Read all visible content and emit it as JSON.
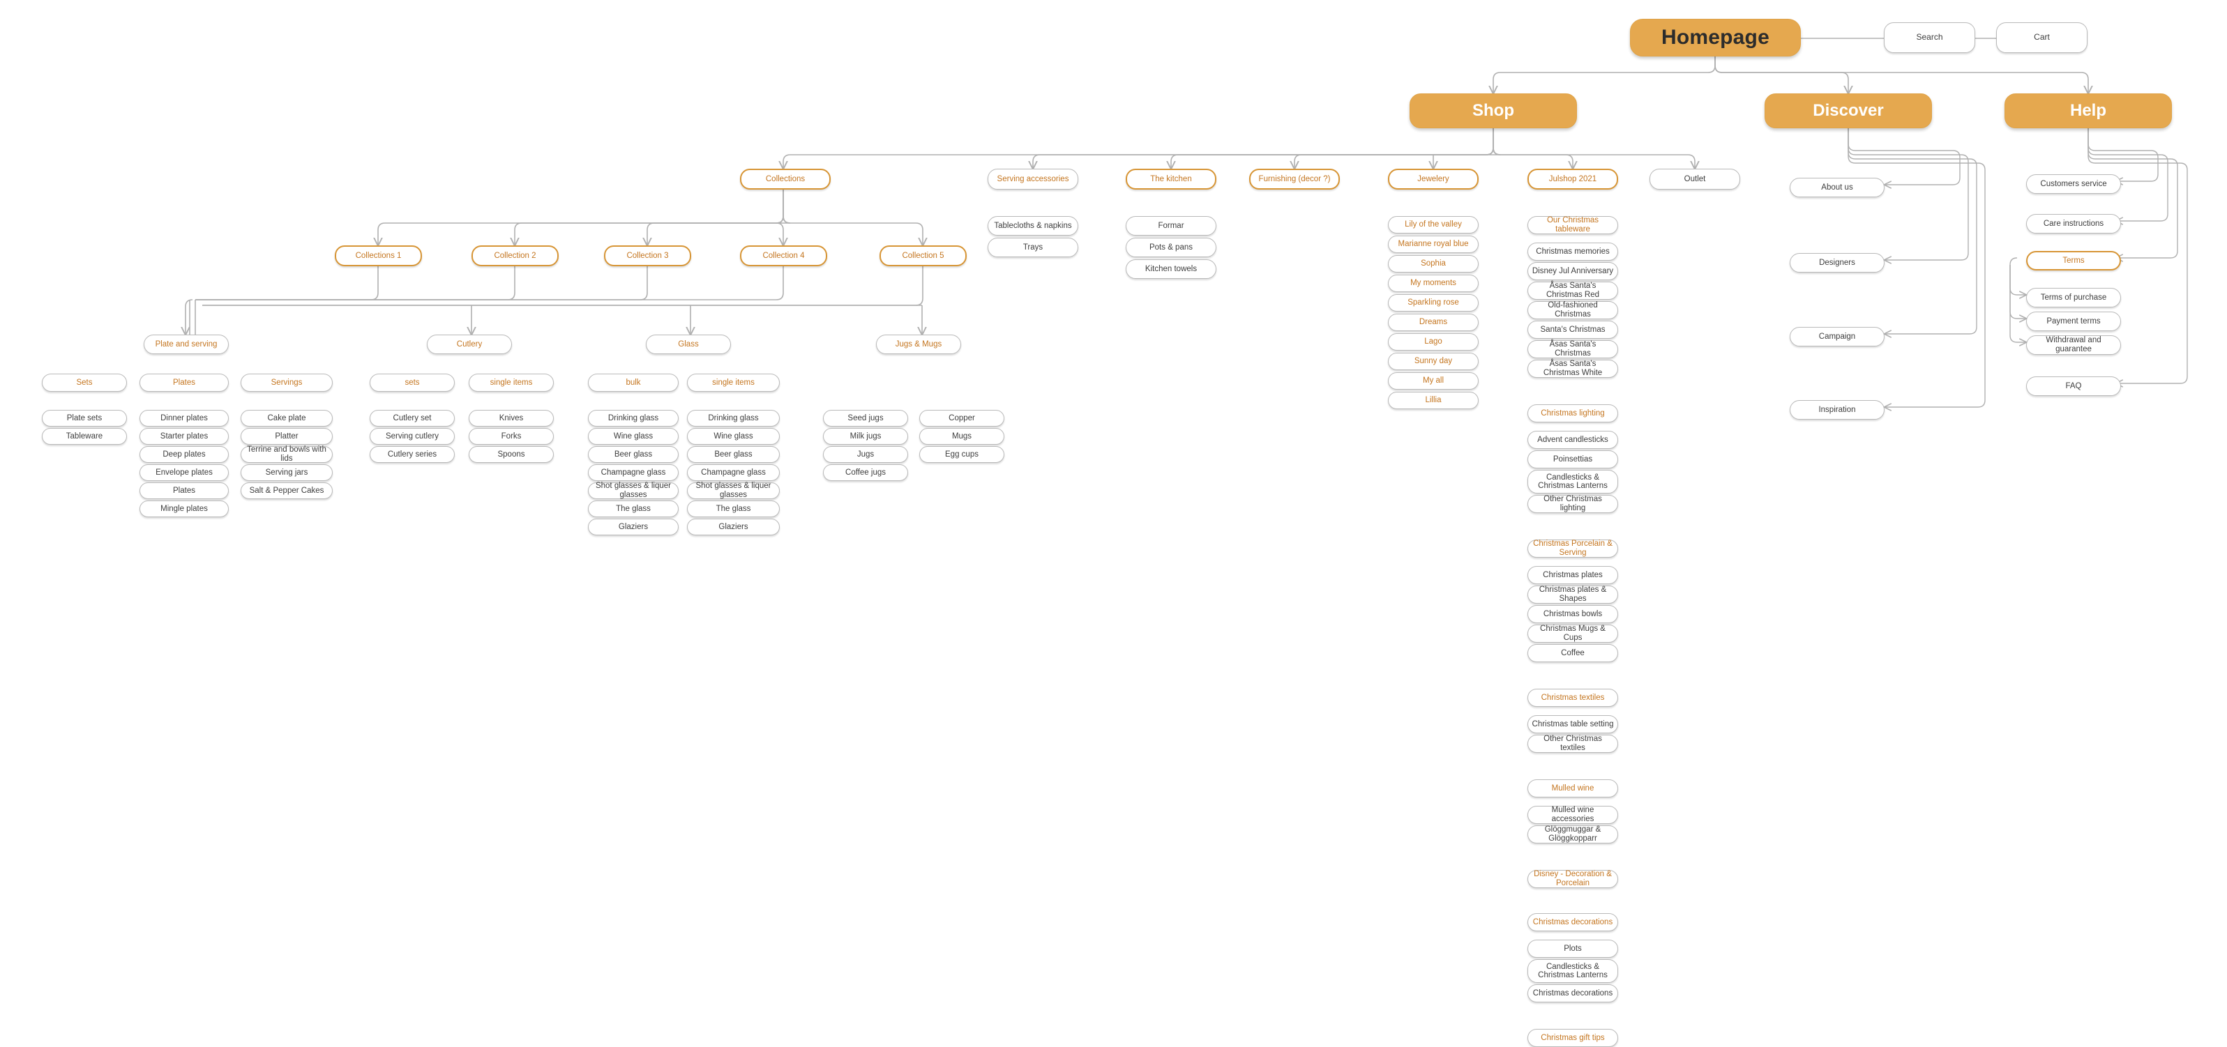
{
  "meta": {
    "diagram_title": "Homepage sitemap",
    "colors": {
      "accent": "#e5a84f",
      "accent_border": "#d79535",
      "accent_text": "#c4751f",
      "node_border": "#b9b9b9",
      "node_text": "#3d3d3d",
      "wire": "#b0b0b0",
      "background": "#ffffff"
    }
  },
  "root": {
    "label": "Homepage"
  },
  "utility": [
    {
      "label": "Search"
    },
    {
      "label": "Cart"
    }
  ],
  "sections": [
    {
      "label": "Shop"
    },
    {
      "label": "Discover"
    },
    {
      "label": "Help"
    }
  ],
  "shop_level2": [
    {
      "label": "Collections",
      "style": "highlight"
    },
    {
      "label": "Serving accessories",
      "style": "orange-text"
    },
    {
      "label": "The kitchen",
      "style": "highlight"
    },
    {
      "label": "Furnishing (decor ?)",
      "style": "highlight"
    },
    {
      "label": "Jewelery",
      "style": "highlight"
    },
    {
      "label": "Julshop 2021",
      "style": "highlight"
    },
    {
      "label": "Outlet",
      "style": "plain"
    }
  ],
  "serving_accessories_children": [
    {
      "label": "Tablecloths & napkins"
    },
    {
      "label": "Trays"
    }
  ],
  "kitchen_children": [
    {
      "label": "Formar"
    },
    {
      "label": "Pots & pans"
    },
    {
      "label": "Kitchen towels"
    }
  ],
  "jewelery_children": [
    {
      "label": "Lily of the valley"
    },
    {
      "label": "Marianne royal blue"
    },
    {
      "label": "Sophia"
    },
    {
      "label": "My moments"
    },
    {
      "label": "Sparkling rose"
    },
    {
      "label": "Dreams"
    },
    {
      "label": "Lago"
    },
    {
      "label": "Sunny day"
    },
    {
      "label": "My all"
    },
    {
      "label": "Lillia"
    }
  ],
  "collections": [
    {
      "label": "Collections 1"
    },
    {
      "label": "Collection 2"
    },
    {
      "label": "Collection 3"
    },
    {
      "label": "Collection 4"
    },
    {
      "label": "Collection 5"
    }
  ],
  "product_groups": [
    {
      "label": "Plate and serving",
      "columns": [
        {
          "label": "Sets",
          "items": [
            "Plate sets",
            "Tableware"
          ]
        },
        {
          "label": "Plates",
          "items": [
            "Dinner plates",
            "Starter plates",
            "Deep plates",
            "Envelope plates",
            "Plates",
            "Mingle plates"
          ]
        },
        {
          "label": "Servings",
          "items": [
            "Cake plate",
            "Platter",
            "Terrine and bowls with lids",
            "Serving jars",
            "Salt & Pepper Cakes"
          ]
        }
      ]
    },
    {
      "label": "Cutlery",
      "columns": [
        {
          "label": "sets",
          "items": [
            "Cutlery set",
            "Serving cutlery",
            "Cutlery series"
          ]
        },
        {
          "label": "single items",
          "items": [
            "Knives",
            "Forks",
            "Spoons"
          ]
        }
      ]
    },
    {
      "label": "Glass",
      "columns": [
        {
          "label": "bulk",
          "items": [
            "Drinking glass",
            "Wine glass",
            "Beer glass",
            "Champagne glass",
            "Shot glasses & liquer glasses",
            "The glass",
            "Glaziers"
          ]
        },
        {
          "label": "single items",
          "items": [
            "Drinking glass",
            "Wine glass",
            "Beer glass",
            "Champagne glass",
            "Shot glasses & liquer glasses",
            "The glass",
            "Glaziers"
          ]
        }
      ]
    },
    {
      "label": "Jugs & Mugs",
      "columns": [
        {
          "label": "",
          "items": [
            "Seed jugs",
            "Milk jugs",
            "Jugs",
            "Coffee jugs"
          ]
        },
        {
          "label": "",
          "items": [
            "Copper",
            "Mugs",
            "Egg cups"
          ]
        }
      ]
    }
  ],
  "julshop_groups": [
    {
      "heading": "Our Christmas tableware",
      "items": [
        "Christmas memories",
        "Disney Jul Anniversary",
        "Åsas Santa's Christmas Red",
        "Old-fashioned Christmas",
        "Santa's Christmas",
        "Åsas Santa's Christmas",
        "Åsas Santa's Christmas White"
      ]
    },
    {
      "heading": "Christmas lighting",
      "items": [
        "Advent candlesticks",
        "Poinsettias",
        "Candlesticks & Christmas Lanterns",
        "Other Christmas lighting"
      ]
    },
    {
      "heading": "Christmas Porcelain & Serving",
      "items": [
        "Christmas plates",
        "Christmas plates & Shapes",
        "Christmas bowls",
        "Christmas Mugs & Cups",
        "Coffee"
      ]
    },
    {
      "heading": "Christmas textiles",
      "items": [
        "Christmas table setting",
        "Other Christmas textiles"
      ]
    },
    {
      "heading": "Mulled wine",
      "items": [
        "Mulled wine accessories",
        "Glöggmuggar & Glöggkopparr"
      ]
    },
    {
      "heading": "Disney - Decoration & Porcelain",
      "items": []
    },
    {
      "heading": "Christmas decorations",
      "items": [
        "Plots",
        "Candlesticks &  Christmas Lanterns",
        "Christmas decorations"
      ]
    },
    {
      "heading": "Christmas gift tips",
      "items": []
    }
  ],
  "discover_children": [
    {
      "label": "About us"
    },
    {
      "label": "Designers"
    },
    {
      "label": "Campaign"
    },
    {
      "label": "Inspiration"
    }
  ],
  "help_children": [
    {
      "label": "Customers service",
      "style": "plain"
    },
    {
      "label": "Care instructions",
      "style": "plain"
    },
    {
      "label": "Terms",
      "style": "highlight"
    },
    {
      "label": "FAQ",
      "style": "plain"
    }
  ],
  "terms_children": [
    {
      "label": "Terms of purchase"
    },
    {
      "label": "Payment terms"
    },
    {
      "label": "Withdrawal and guarantee"
    }
  ]
}
